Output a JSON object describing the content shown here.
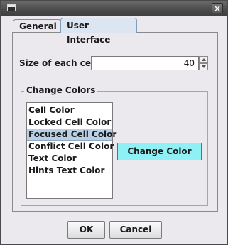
{
  "window": {
    "close_icon": "×"
  },
  "tabs": [
    {
      "label": "General"
    },
    {
      "label": "User Interface"
    }
  ],
  "settings": {
    "size_label": "Size of each cell",
    "size_value": "40"
  },
  "colors_group": {
    "title": "Change Colors",
    "items": [
      {
        "label": "Cell Color"
      },
      {
        "label": "Locked Cell Color"
      },
      {
        "label": "Focused Cell Color"
      },
      {
        "label": "Conflict Cell Color"
      },
      {
        "label": "Text Color"
      },
      {
        "label": "Hints Text Color"
      }
    ],
    "selected_index": 2,
    "change_button": "Change Color"
  },
  "buttons": {
    "ok": "OK",
    "cancel": "Cancel"
  }
}
